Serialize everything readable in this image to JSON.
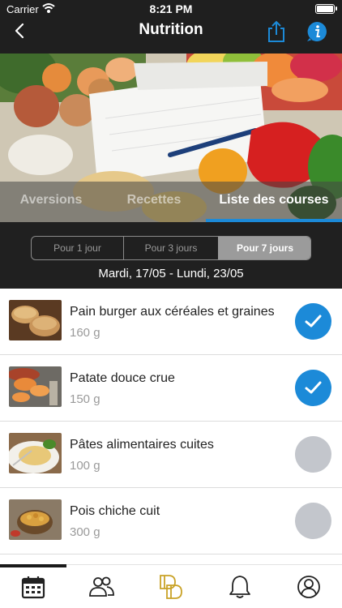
{
  "status_bar": {
    "carrier": "Carrier",
    "time": "8:21 PM"
  },
  "header": {
    "title": "Nutrition",
    "back_icon": "chevron-left-icon",
    "share_icon": "share-icon",
    "info_icon": "info-icon",
    "accent_color": "#1c8ad8"
  },
  "tabs": [
    {
      "label": "Aversions",
      "active": false
    },
    {
      "label": "Recettes",
      "active": false
    },
    {
      "label": "Liste des courses",
      "active": true
    }
  ],
  "period": {
    "options": [
      "Pour 1 jour",
      "Pour 3 jours",
      "Pour 7 jours"
    ],
    "selected": "Pour 7 jours",
    "date_range": "Mardi, 17/05 - Lundi, 23/05"
  },
  "items": [
    {
      "name": "Pain burger aux céréales et graines",
      "quantity": "160 g",
      "checked": true
    },
    {
      "name": "Patate douce crue",
      "quantity": "150 g",
      "checked": true
    },
    {
      "name": "Pâtes alimentaires cuites",
      "quantity": "100 g",
      "checked": false
    },
    {
      "name": "Pois chiche cuit",
      "quantity": "300 g",
      "checked": false
    }
  ],
  "bottom_nav": [
    {
      "icon": "calendar-icon",
      "active": true
    },
    {
      "icon": "community-icon",
      "active": false
    },
    {
      "icon": "brand-logo-icon",
      "active": false
    },
    {
      "icon": "bell-icon",
      "active": false
    },
    {
      "icon": "profile-icon",
      "active": false
    }
  ]
}
